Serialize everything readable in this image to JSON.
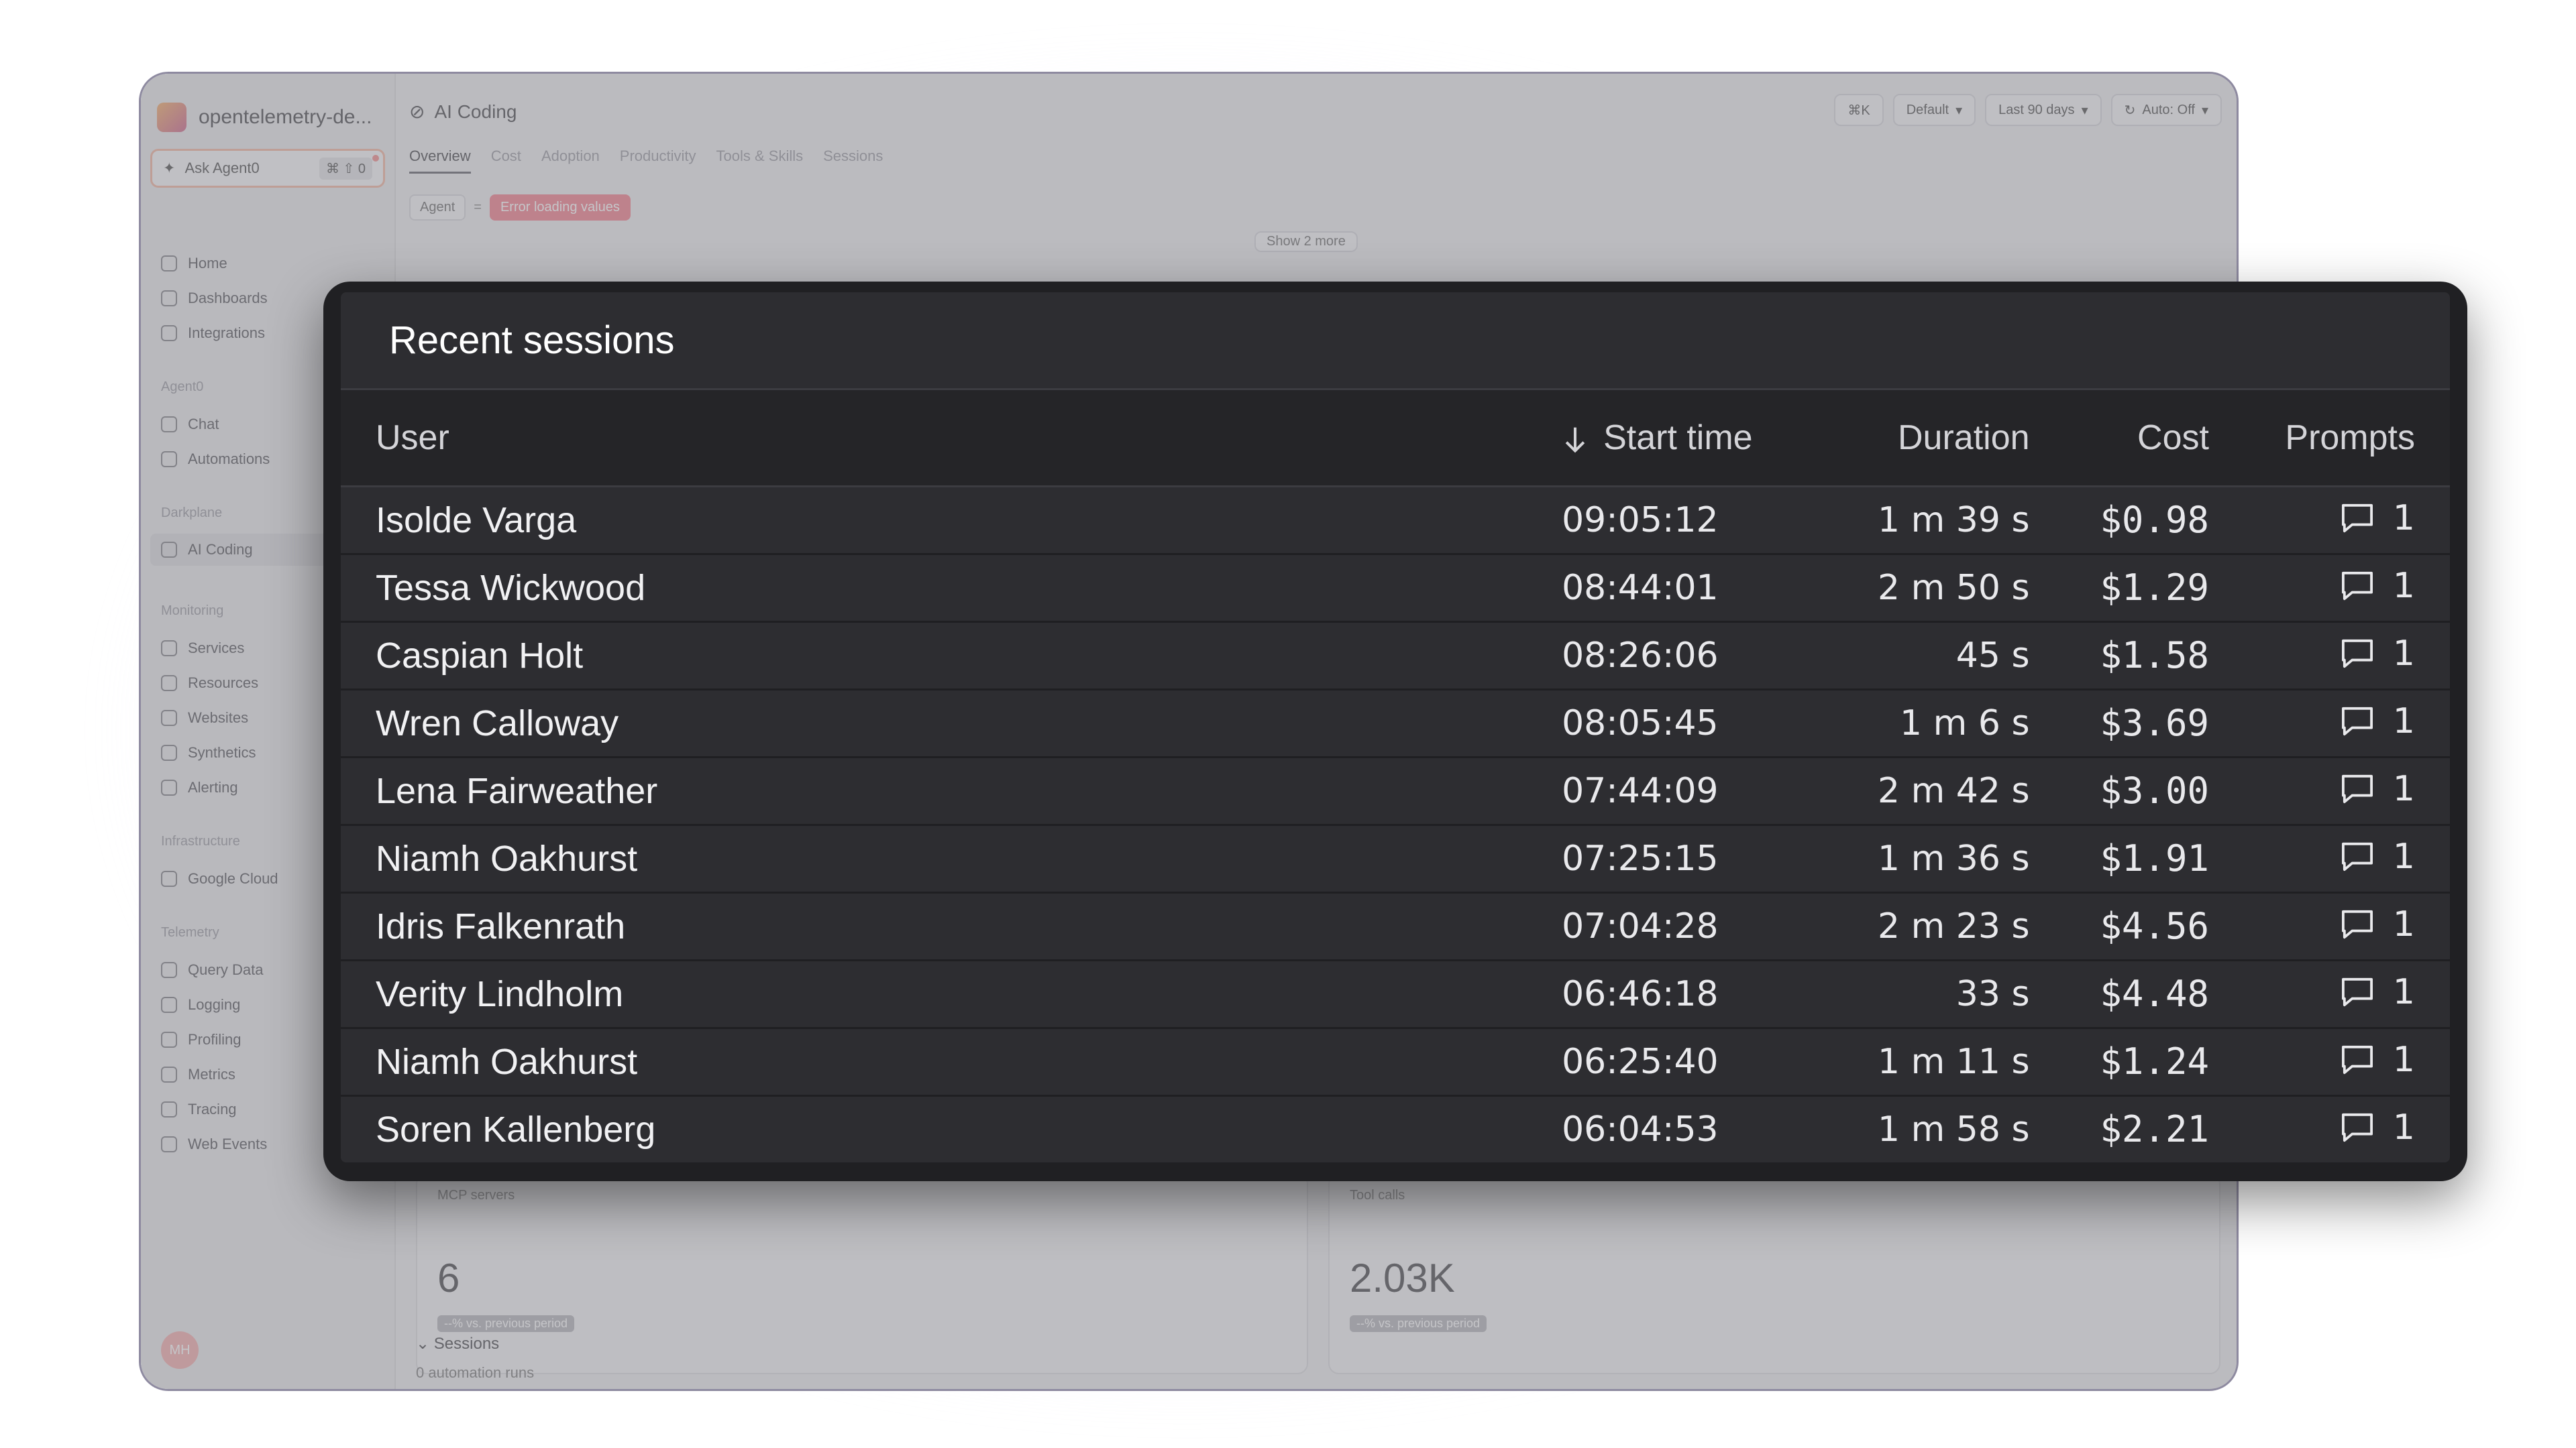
{
  "app": {
    "org_name": "opentelemetry-de...",
    "ask_label": "Ask Agent0",
    "ask_shortcut": "⌘ ⇧ 0",
    "breadcrumb": "AI Coding",
    "header_controls": [
      "⌘K",
      "Default",
      "Last 90 days",
      "Auto: Off"
    ],
    "tabs": [
      "Overview",
      "Cost",
      "Adoption",
      "Productivity",
      "Tools & Skills",
      "Sessions"
    ],
    "active_tab": "Overview",
    "filter_label": "Agent",
    "filter_op": "=",
    "filter_error": "Error loading values",
    "show_more": "Show 2 more",
    "sidebar": {
      "top": [
        "Home",
        "Dashboards",
        "Integrations"
      ],
      "agent0_header": "Agent0",
      "agent0": [
        "Chat",
        "Automations"
      ],
      "darkplane_header": "Darkplane",
      "darkplane": [
        "AI Coding"
      ],
      "monitoring_header": "Monitoring",
      "monitoring": [
        "Services",
        "Resources",
        "Websites",
        "Synthetics",
        "Alerting"
      ],
      "infra_header": "Infrastructure",
      "infra": [
        "Google Cloud"
      ],
      "telemetry_header": "Telemetry",
      "telemetry": [
        "Query Data",
        "Logging",
        "Profiling",
        "Metrics",
        "Tracing",
        "Web Events"
      ]
    },
    "avatar_initials": "MH",
    "stats": [
      {
        "label": "MCP servers",
        "value": "6",
        "delta": "--% vs. previous period"
      },
      {
        "label": "Tool calls",
        "value": "2.03K",
        "delta": "--% vs. previous period"
      }
    ],
    "sessions_header": "Sessions",
    "automation_runs": "0 automation runs"
  },
  "modal": {
    "title": "Recent sessions",
    "columns": {
      "user": "User",
      "start": "Start time",
      "duration": "Duration",
      "cost": "Cost",
      "prompts": "Prompts"
    },
    "rows": [
      {
        "user": "Isolde Varga",
        "start": "09:05:12",
        "duration": "1 m 39 s",
        "cost": "$0.98",
        "prompts": "1"
      },
      {
        "user": "Tessa Wickwood",
        "start": "08:44:01",
        "duration": "2 m 50 s",
        "cost": "$1.29",
        "prompts": "1"
      },
      {
        "user": "Caspian Holt",
        "start": "08:26:06",
        "duration": "45 s",
        "cost": "$1.58",
        "prompts": "1"
      },
      {
        "user": "Wren Calloway",
        "start": "08:05:45",
        "duration": "1 m 6 s",
        "cost": "$3.69",
        "prompts": "1"
      },
      {
        "user": "Lena Fairweather",
        "start": "07:44:09",
        "duration": "2 m 42 s",
        "cost": "$3.00",
        "prompts": "1"
      },
      {
        "user": "Niamh Oakhurst",
        "start": "07:25:15",
        "duration": "1 m 36 s",
        "cost": "$1.91",
        "prompts": "1"
      },
      {
        "user": "Idris Falkenrath",
        "start": "07:04:28",
        "duration": "2 m 23 s",
        "cost": "$4.56",
        "prompts": "1"
      },
      {
        "user": "Verity Lindholm",
        "start": "06:46:18",
        "duration": "33 s",
        "cost": "$4.48",
        "prompts": "1"
      },
      {
        "user": "Niamh Oakhurst",
        "start": "06:25:40",
        "duration": "1 m 11 s",
        "cost": "$1.24",
        "prompts": "1"
      },
      {
        "user": "Soren Kallenberg",
        "start": "06:04:53",
        "duration": "1 m 58 s",
        "cost": "$2.21",
        "prompts": "1"
      }
    ]
  }
}
